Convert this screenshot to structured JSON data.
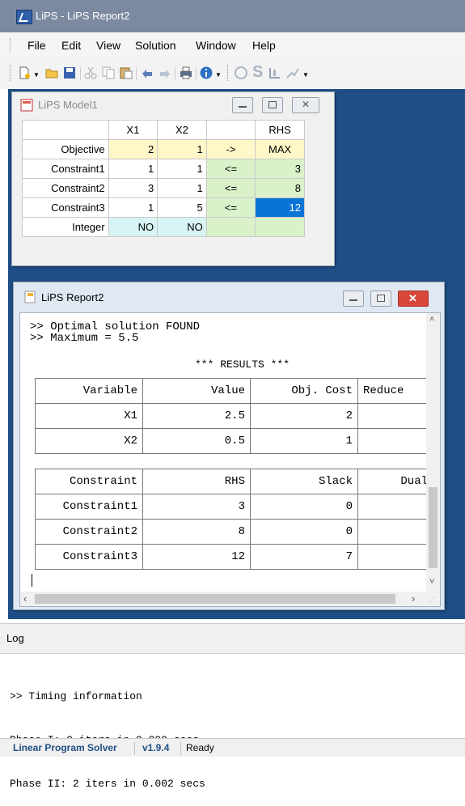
{
  "window": {
    "title": "LiPS - LiPS Report2"
  },
  "menu": [
    "File",
    "Edit",
    "View",
    "Solution",
    "Window",
    "Help"
  ],
  "toolbar_icons": [
    "new-icon",
    "open-icon",
    "save-icon",
    "cut-icon",
    "copy-icon",
    "paste-icon",
    "undo-icon",
    "redo-icon",
    "print-icon",
    "info-icon",
    "run-icon",
    "s-icon",
    "chart-icon",
    "graph-icon"
  ],
  "model": {
    "title": "LiPS Model1",
    "headers": [
      "",
      "X1",
      "X2",
      "",
      "RHS"
    ],
    "rows": [
      {
        "label": "Objective",
        "x1": "2",
        "x2": "1",
        "op": "->",
        "rhs": "MAX"
      },
      {
        "label": "Constraint1",
        "x1": "1",
        "x2": "1",
        "op": "<=",
        "rhs": "3"
      },
      {
        "label": "Constraint2",
        "x1": "3",
        "x2": "1",
        "op": "<=",
        "rhs": "8"
      },
      {
        "label": "Constraint3",
        "x1": "1",
        "x2": "5",
        "op": "<=",
        "rhs": "12"
      },
      {
        "label": "Integer",
        "x1": "NO",
        "x2": "NO",
        "op": "",
        "rhs": ""
      }
    ]
  },
  "report": {
    "title": "LiPS Report2",
    "line1": ">> Optimal solution FOUND",
    "line2": ">> Maximum = 5.5",
    "results_header": "*** RESULTS ***",
    "var_headers": [
      "Variable",
      "Value",
      "Obj. Cost",
      "Reduce"
    ],
    "vars": [
      {
        "name": "X1",
        "value": "2.5",
        "cost": "2",
        "reduced": ""
      },
      {
        "name": "X2",
        "value": "0.5",
        "cost": "1",
        "reduced": ""
      }
    ],
    "con_headers": [
      "Constraint",
      "RHS",
      "Slack",
      "Dual"
    ],
    "cons": [
      {
        "name": "Constraint1",
        "rhs": "3",
        "slack": "0",
        "dual": ""
      },
      {
        "name": "Constraint2",
        "rhs": "8",
        "slack": "0",
        "dual": ""
      },
      {
        "name": "Constraint3",
        "rhs": "12",
        "slack": "7",
        "dual": ""
      }
    ]
  },
  "log": {
    "title": "Log",
    "lines": [
      ">> Timing information",
      "Phase I: 0 iters in 0.000 secs",
      "Phase II: 2 iters in 0.002 secs"
    ]
  },
  "status": {
    "app": "Linear Program Solver",
    "version": "v1.9.4",
    "state": "Ready"
  },
  "colors": {
    "mdi_bg": "#1f4e86",
    "yellow_cell": "#fff7c8",
    "green_cell": "#d9f2c9",
    "cyan_cell": "#d8f3f3",
    "selected_cell": "#0a74d6",
    "close_red": "#d9473c"
  }
}
